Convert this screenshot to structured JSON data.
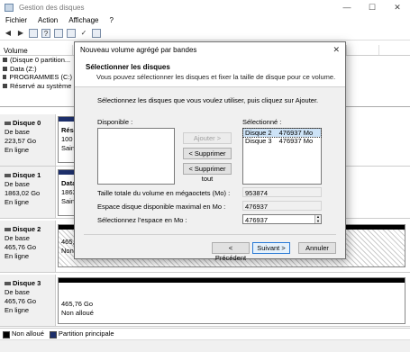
{
  "window": {
    "title": "Gestion des disques",
    "controls": [
      "—",
      "☐",
      "✕"
    ]
  },
  "menu": [
    "Fichier",
    "Action",
    "Affichage",
    "?"
  ],
  "volume_list": {
    "header": "Volume",
    "items": [
      "(Disque 0 partition...",
      "Data (Z:)",
      "PROGRAMMES (C:)",
      "Réservé au système"
    ]
  },
  "disks": [
    {
      "name": "Disque 0",
      "type": "De base",
      "size": "223,57 Go",
      "status": "En ligne",
      "part_lines": [
        "Rés",
        "100",
        "Sain"
      ]
    },
    {
      "name": "Disque 1",
      "type": "De base",
      "size": "1863,02 Go",
      "status": "En ligne",
      "part_lines": [
        "Data",
        "1863",
        "Sain"
      ]
    },
    {
      "name": "Disque 2",
      "type": "De base",
      "size": "465,76 Go",
      "status": "En ligne",
      "part_lines": [
        "465,7",
        "Non"
      ]
    },
    {
      "name": "Disque 3",
      "type": "De base",
      "size": "465,76 Go",
      "status": "En ligne",
      "part_lines": [
        "465,76 Go",
        "Non alloué"
      ]
    }
  ],
  "legend": [
    {
      "label": "Non alloué",
      "color": "#000000"
    },
    {
      "label": "Partition principale",
      "color": "#1d2f6b"
    }
  ],
  "dialog": {
    "title": "Nouveau volume agrégé par bandes",
    "close": "✕",
    "heading": "Sélectionner les disques",
    "subheading": "Vous pouvez sélectionner les disques et fixer la taille de disque pour ce volume.",
    "instruction": "Sélectionnez les disques que vous voulez utiliser, puis cliquez sur Ajouter.",
    "available_label": "Disponible :",
    "selected_label": "Sélectionné :",
    "selected_items": [
      {
        "disk": "Disque 2",
        "size": "476937 Mo"
      },
      {
        "disk": "Disque 3",
        "size": "476937 Mo"
      }
    ],
    "add_btn": "Ajouter >",
    "remove_btn": "< Supprimer",
    "remove_all_btn": "< Supprimer tout",
    "total_label": "Taille totale du volume en mégaoctets (Mo) :",
    "total_value": "953874",
    "max_label": "Espace disque disponible maximal en Mo :",
    "max_value": "476937",
    "select_label": "Sélectionnez l’espace en Mo :",
    "select_value": "476937",
    "back_btn": "< Précédent",
    "next_btn": "Suivant >",
    "cancel_btn": "Annuler"
  }
}
